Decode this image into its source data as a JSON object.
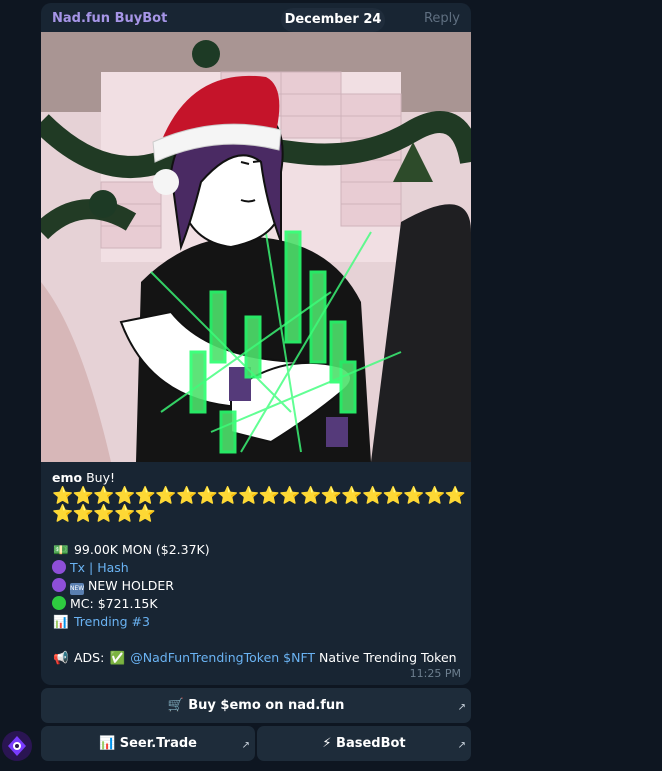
{
  "message": {
    "sender": "Nad.fun BuyBot",
    "date_pill": "December 24",
    "reply_label": "Reply",
    "title_token": "emo",
    "title_action": " Buy!",
    "stars_line1": "⭐⭐⭐⭐⭐⭐⭐⭐⭐⭐⭐⭐⭐⭐⭐⭐⭐⭐⭐⭐",
    "stars_line2": "⭐⭐⭐⭐⭐",
    "amount_emoji": "💵",
    "amount": "99.00K MON ($2.37K)",
    "tx_label": "Tx",
    "tx_sep": " | ",
    "hash_label": "Hash",
    "new_badge": "NEW",
    "new_holder": "NEW HOLDER",
    "mc": "MC: $721.15K",
    "chart_emoji": "📊",
    "trending": "Trending #3",
    "ads_emoji": "📢",
    "ads_label": "ADS:",
    "check_emoji": "✅",
    "ads_link": "@NadFunTrendingToken $NFT",
    "ads_text": " Native Trending Token",
    "time": "11:25 PM"
  },
  "buttons": {
    "buy": "🛒 Buy $emo on nad.fun",
    "seer": "📊 Seer.Trade",
    "based": "⚡ BasedBot",
    "arrow": "↗"
  },
  "colors": {
    "background": "#0e1621",
    "bubble": "#182533",
    "sender": "#a695e7",
    "link": "#6ab3f3",
    "button": "#1e2c3a"
  }
}
